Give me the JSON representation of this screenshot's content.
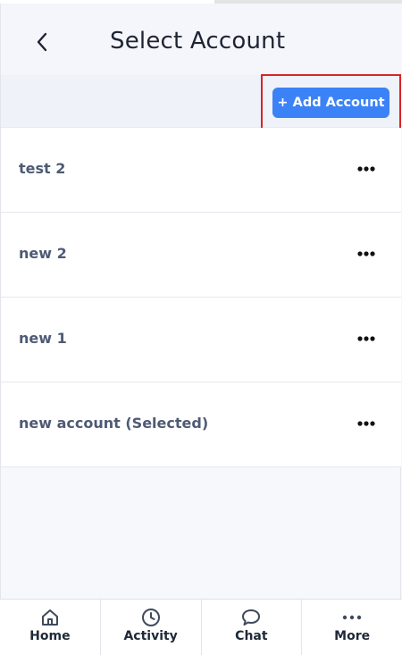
{
  "header": {
    "title": "Select Account",
    "back_icon": "chevron-left-icon"
  },
  "actions": {
    "add_account_label": "+ Add Account",
    "accent": "#3b82f6",
    "highlight_color": "#dd2227"
  },
  "accounts": [
    {
      "label": "test 2",
      "menu_icon": "more-horizontal-icon"
    },
    {
      "label": "new 2",
      "menu_icon": "more-horizontal-icon"
    },
    {
      "label": "new 1",
      "menu_icon": "more-horizontal-icon"
    },
    {
      "label": "new account (Selected)",
      "menu_icon": "more-horizontal-icon"
    }
  ],
  "tabbar": {
    "items": [
      {
        "label": "Home",
        "icon": "home-icon"
      },
      {
        "label": "Activity",
        "icon": "clock-icon"
      },
      {
        "label": "Chat",
        "icon": "chat-bubble-icon"
      },
      {
        "label": "More",
        "icon": "more-horizontal-icon"
      }
    ]
  }
}
